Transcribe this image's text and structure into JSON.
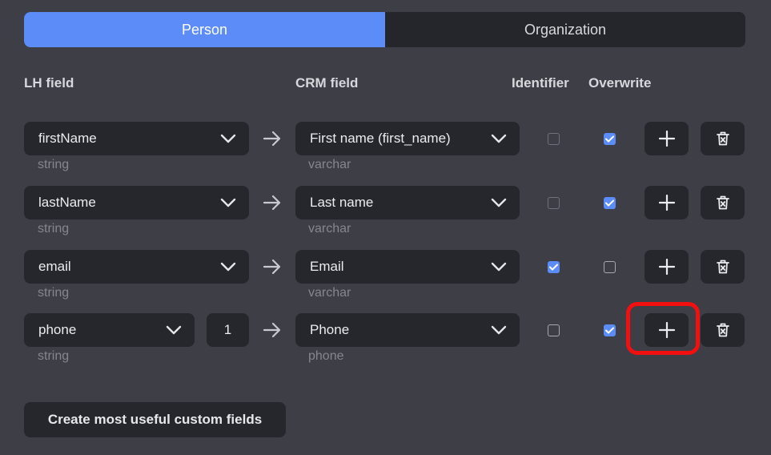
{
  "tabs": [
    {
      "label": "Person",
      "active": true
    },
    {
      "label": "Organization",
      "active": false
    }
  ],
  "headers": {
    "lh_field": "LH field",
    "crm_field": "CRM field",
    "identifier": "Identifier",
    "overwrite": "Overwrite"
  },
  "rows": [
    {
      "lh": "firstName",
      "lh_type": "string",
      "crm": "First name (first_name)",
      "crm_type": "varchar",
      "identifier": false,
      "overwrite": true
    },
    {
      "lh": "lastName",
      "lh_type": "string",
      "crm": "Last name",
      "crm_type": "varchar",
      "identifier": false,
      "overwrite": true
    },
    {
      "lh": "email",
      "lh_type": "string",
      "crm": "Email",
      "crm_type": "varchar",
      "identifier": true,
      "overwrite": false
    },
    {
      "lh": "phone",
      "lh_index": "1",
      "lh_type": "string",
      "crm": "Phone",
      "crm_type": "phone",
      "identifier": false,
      "overwrite": true
    }
  ],
  "icons": {
    "dropdown": "chevron-down-icon",
    "mapping": "arrow-right-icon",
    "add": "plus-icon",
    "delete": "trash-icon"
  },
  "highlighted_button": "add-row-button-4",
  "create_custom_fields_label": "Create most useful custom fields",
  "colors": {
    "accent": "#5b8cf7",
    "background": "#3d3e46",
    "control": "#26272c",
    "highlight": "#f20f0f"
  }
}
